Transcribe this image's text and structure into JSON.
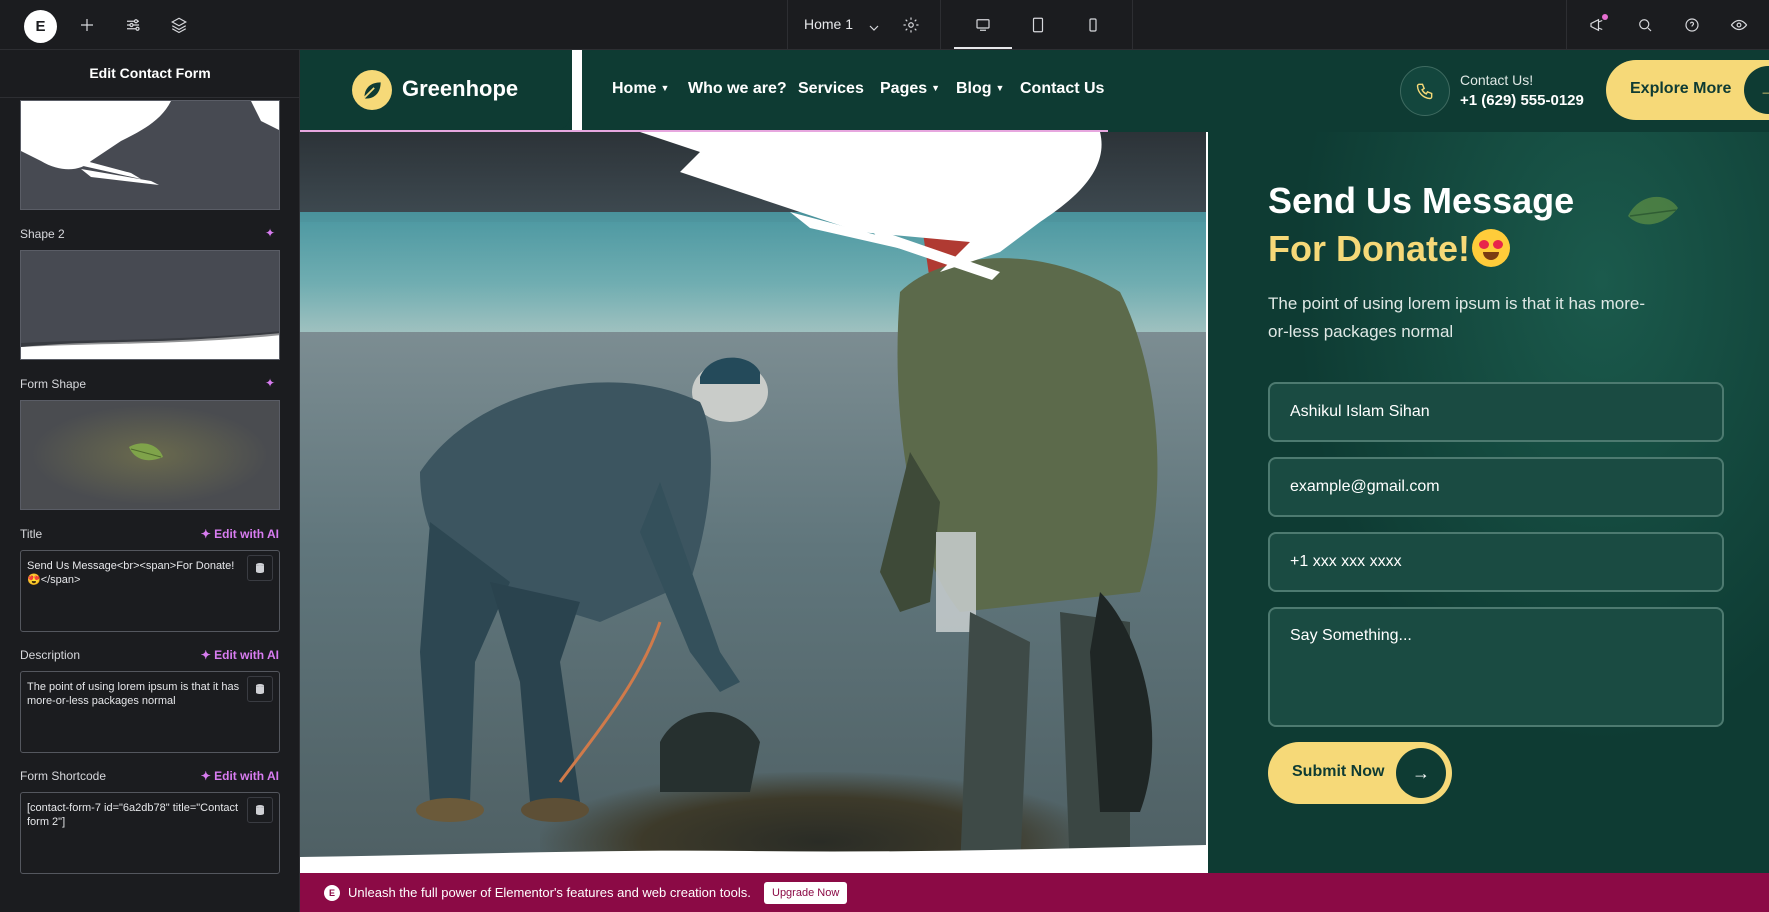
{
  "topbar": {
    "page_name": "Home 1"
  },
  "panel": {
    "header": "Edit Contact Form",
    "shape2_label": "Shape 2",
    "form_shape_label": "Form Shape",
    "title_label": "Title",
    "title_value": "Send Us Message<br><span>For Donate!😍</span>",
    "description_label": "Description",
    "description_value": "The point of using lorem ipsum is that it has more-or-less packages normal",
    "shortcode_label": "Form Shortcode",
    "shortcode_value": "[contact-form-7 id=\"6a2db78\" title=\"Contact form 2\"]",
    "edit_ai_label": "Edit with AI"
  },
  "site": {
    "logo_text": "Greenhope",
    "nav": [
      {
        "label": "Home",
        "has_caret": true
      },
      {
        "label": "Who we are?",
        "has_caret": false
      },
      {
        "label": "Services",
        "has_caret": false
      },
      {
        "label": "Pages",
        "has_caret": true
      },
      {
        "label": "Blog",
        "has_caret": true
      },
      {
        "label": "Contact Us",
        "has_caret": false
      }
    ],
    "contact_label": "Contact Us!",
    "contact_phone": "+1 (629) 555-0129",
    "explore_label": "Explore More",
    "form": {
      "title_line1": "Send Us Message",
      "title_line2": "For Donate!",
      "description": "The point of using lorem ipsum is that it has more-or-less packages normal",
      "name_value": "Ashikul Islam Sihan",
      "email_value": "example@gmail.com",
      "phone_value": "+1 xxx xxx xxxx",
      "message_placeholder": "Say Something...",
      "submit_label": "Submit Now"
    }
  },
  "promo": {
    "text": "Unleash the full power of Elementor's features and web creation tools.",
    "button": "Upgrade Now"
  },
  "colors": {
    "brand_green": "#0e3b33",
    "brand_yellow": "#f6d978",
    "promo_bg": "#8b0a45",
    "ai_accent": "#d87cf0"
  },
  "icons": [
    "elementor-logo-icon",
    "add-icon",
    "settings-sliders-icon",
    "layers-icon",
    "page-settings-icon",
    "desktop-icon",
    "tablet-icon",
    "mobile-icon",
    "announcements-icon",
    "search-icon",
    "help-icon",
    "preview-eye-icon",
    "phone-icon",
    "arrow-right-icon",
    "database-icon",
    "sparkle-icon",
    "leaf-icon"
  ]
}
